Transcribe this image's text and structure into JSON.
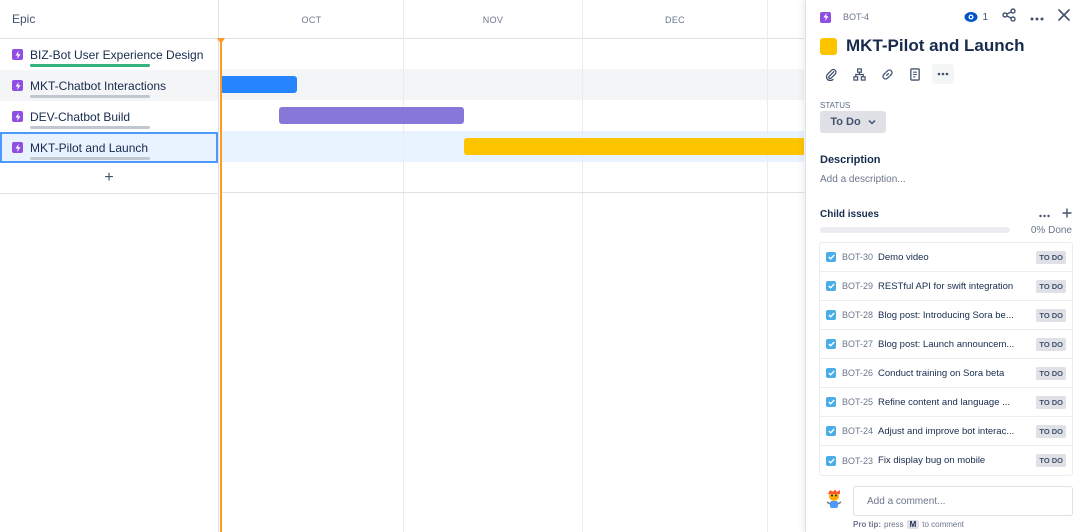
{
  "epic_panel": {
    "header": "Epic",
    "epics": [
      {
        "label": "BIZ-Bot User Experience Design",
        "progress": 1.0,
        "progress_color": "#36b37e"
      },
      {
        "label": "MKT-Chatbot Interactions",
        "progress": 0,
        "progress_color": "#c1c7d0"
      },
      {
        "label": "DEV-Chatbot Build",
        "progress": 0,
        "progress_color": "#c1c7d0"
      },
      {
        "label": "MKT-Pilot and Launch",
        "progress": 0,
        "progress_color": "#c1c7d0"
      }
    ],
    "add_symbol": "+"
  },
  "timeline": {
    "months": [
      "OCT",
      "NOV",
      "DEC"
    ],
    "bars": [
      {
        "epic": "MKT-Chatbot Interactions",
        "color": "#2684ff"
      },
      {
        "epic": "DEV-Chatbot Build",
        "color": "#8777d9"
      },
      {
        "epic": "MKT-Pilot and Launch",
        "color": "#ffc400"
      }
    ],
    "today_color": "#ff991f"
  },
  "detail": {
    "issue_key": "BOT-4",
    "watch_count": "1",
    "title": "MKT-Pilot and Launch",
    "epic_color": "#ffc400",
    "status_label": "STATUS",
    "status_value": "To Do",
    "description_heading": "Description",
    "description_placeholder": "Add a description...",
    "child_heading": "Child issues",
    "child_done": "0% Done",
    "children": [
      {
        "key": "BOT-30",
        "summary": "Demo video",
        "status": "TO DO"
      },
      {
        "key": "BOT-29",
        "summary": "RESTful API for swift integration",
        "status": "TO DO"
      },
      {
        "key": "BOT-28",
        "summary": "Blog post: Introducing Sora be...",
        "status": "TO DO"
      },
      {
        "key": "BOT-27",
        "summary": "Blog post: Launch announcem...",
        "status": "TO DO"
      },
      {
        "key": "BOT-26",
        "summary": "Conduct training on Sora beta",
        "status": "TO DO"
      },
      {
        "key": "BOT-25",
        "summary": "Refine content and language ...",
        "status": "TO DO"
      },
      {
        "key": "BOT-24",
        "summary": "Adjust and improve bot interac...",
        "status": "TO DO"
      },
      {
        "key": "BOT-23",
        "summary": "Fix display bug on mobile",
        "status": "TO DO"
      }
    ],
    "comment_placeholder": "Add a comment...",
    "pro_tip_label": "Pro tip:",
    "pro_tip_press": "press",
    "pro_tip_key": "M",
    "pro_tip_rest": "to comment"
  }
}
